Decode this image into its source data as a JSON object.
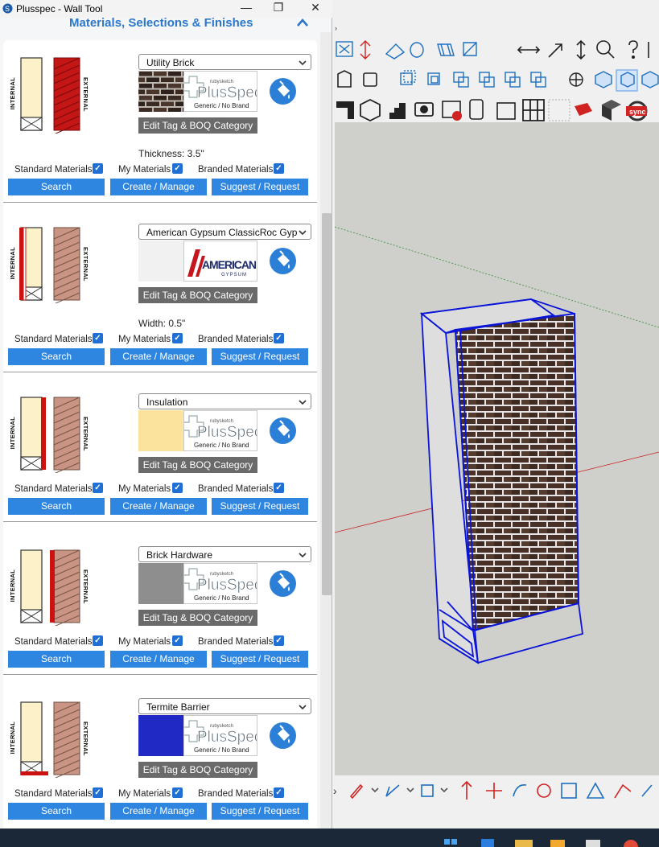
{
  "window": {
    "title": "Plusspec - Wall Tool",
    "minimize": "—",
    "maximize": "❐",
    "close": "✕"
  },
  "header": {
    "title": "Materials, Selections & Finishes",
    "collapse_icon": "chevron-up-icon"
  },
  "labels": {
    "internal": "INTERNAL",
    "external": "EXTERNAL",
    "tag_button": "Edit Tag & BOQ Category"
  },
  "filters": {
    "standard": "Standard Materials",
    "my": "My Materials",
    "branded": "Branded Materials",
    "check": "✓"
  },
  "buttons": {
    "search": "Search",
    "create": "Create / Manage",
    "suggest": "Suggest / Request"
  },
  "brand_logo": {
    "small": "rubysketch",
    "big": "PlusSpec",
    "sub": "Generic / No Brand"
  },
  "american_logo": {
    "big": "AMERICAN",
    "sub": "GYPSUM"
  },
  "layers": [
    {
      "material": "Utility Brick",
      "swatch": "brick",
      "dimension": "Thickness: 3.5\"",
      "brand": "plusspec",
      "highlight": "external"
    },
    {
      "material": "American Gypsum ClassicRoc Gyp",
      "swatch": "#f1f1f1",
      "dimension": "Width: 0.5\"",
      "brand": "american",
      "highlight": "internal-face"
    },
    {
      "material": "Insulation",
      "swatch": "#fce39d",
      "dimension": "",
      "brand": "plusspec",
      "highlight": "cavity-left"
    },
    {
      "material": "Brick Hardware",
      "swatch": "#8e8e8e",
      "dimension": "",
      "brand": "plusspec",
      "highlight": "cavity-right"
    },
    {
      "material": "Termite Barrier",
      "swatch": "#2129c4",
      "dimension": "",
      "brand": "plusspec",
      "highlight": "base"
    }
  ],
  "colors": {
    "accent": "#2c77c9",
    "button": "#2f86e0",
    "tag_button": "#6a6a6a",
    "checkbox": "#1f6fd4",
    "highlight": "#cc1111"
  }
}
